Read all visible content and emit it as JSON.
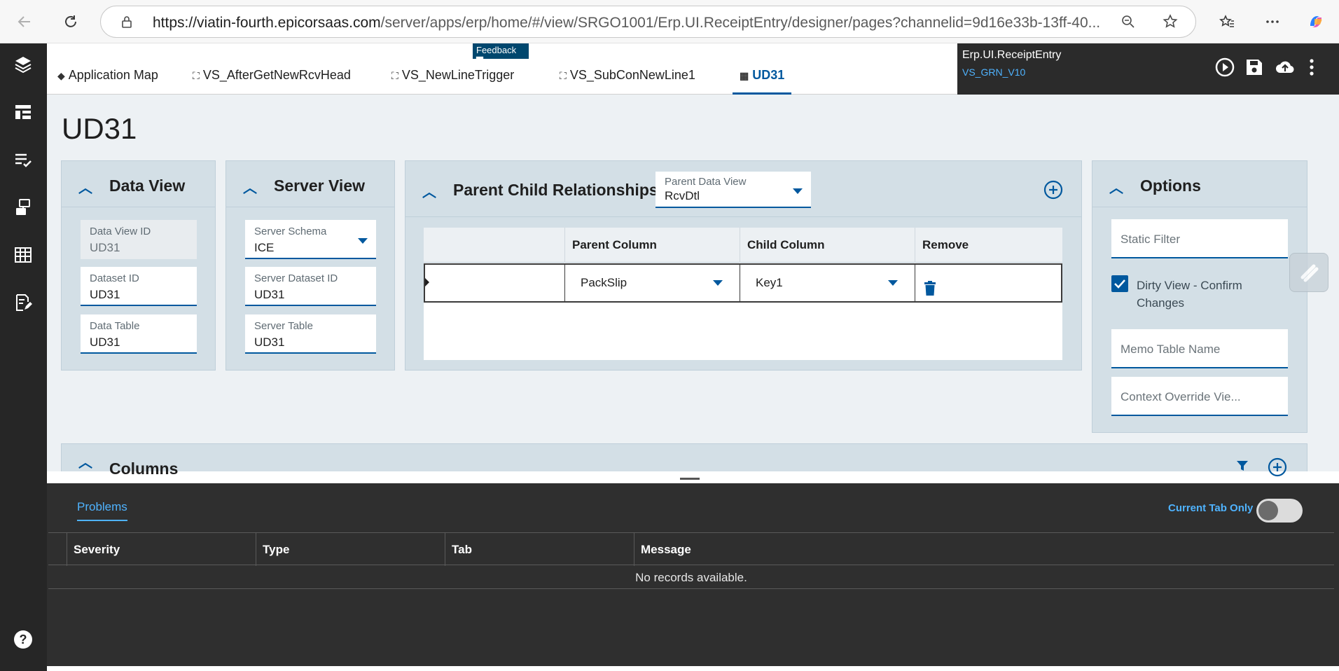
{
  "browser": {
    "url_host": "https://viatin-fourth.epicorsaas.com",
    "url_path": "/server/apps/erp/home/#/view/SRGO1001/Erp.UI.ReceiptEntry/designer/pages?channelid=9d16e33b-13ff-40..."
  },
  "feedback_label": "Feedback",
  "tabs": [
    {
      "label": "Application Map"
    },
    {
      "label": "VS_AfterGetNewRcvHead"
    },
    {
      "label": "VS_NewLineTrigger"
    },
    {
      "label": "VS_SubConNewLine1"
    },
    {
      "label": "UD31"
    }
  ],
  "header": {
    "title": "Erp.UI.ReceiptEntry",
    "subtitle": "VS_GRN_V10"
  },
  "page_title": "UD31",
  "data_view": {
    "title": "Data View",
    "fields": [
      {
        "label": "Data View ID",
        "value": "UD31"
      },
      {
        "label": "Dataset ID",
        "value": "UD31"
      },
      {
        "label": "Data Table",
        "value": "UD31"
      }
    ]
  },
  "server_view": {
    "title": "Server View",
    "fields": [
      {
        "label": "Server Schema",
        "value": "ICE"
      },
      {
        "label": "Server Dataset ID",
        "value": "UD31"
      },
      {
        "label": "Server Table",
        "value": "UD31"
      }
    ]
  },
  "relationships": {
    "title": "Parent Child Relationships",
    "parent_dv_label": "Parent Data View",
    "parent_dv_value": "RcvDtl",
    "columns": [
      "",
      "Parent Column",
      "Child Column",
      "Remove"
    ],
    "rows": [
      {
        "parent": "PackSlip",
        "child": "Key1"
      }
    ]
  },
  "options": {
    "title": "Options",
    "static_filter_placeholder": "Static Filter",
    "dirty_view_label": "Dirty View - Confirm Changes",
    "dirty_view_checked": true,
    "memo_placeholder": "Memo Table Name",
    "context_placeholder": "Context Override Vie..."
  },
  "columns_section": {
    "title": "Columns"
  },
  "bottom_panel": {
    "tab": "Problems",
    "toggle_label": "Current Tab Only",
    "toggle_on": false,
    "headers": [
      "Severity",
      "Type",
      "Tab",
      "Message"
    ],
    "empty_text": "No records available."
  },
  "colors": {
    "accent": "#00589e",
    "link": "#4fb3ff",
    "nav_bg": "#262626",
    "panel_bg": "#d3dfe6"
  }
}
